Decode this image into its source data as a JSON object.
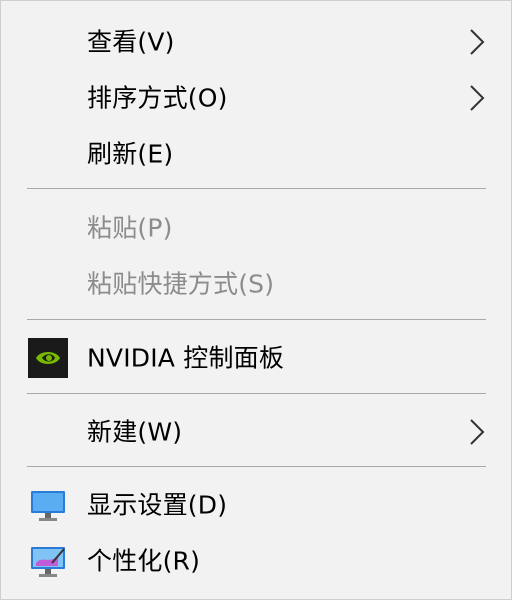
{
  "menu": {
    "items": [
      {
        "label": "查看(V)",
        "submenu": true,
        "enabled": true
      },
      {
        "label": "排序方式(O)",
        "submenu": true,
        "enabled": true
      },
      {
        "label": "刷新(E)",
        "submenu": false,
        "enabled": true
      },
      {
        "label": "粘贴(P)",
        "submenu": false,
        "enabled": false
      },
      {
        "label": "粘贴快捷方式(S)",
        "submenu": false,
        "enabled": false
      },
      {
        "label": "NVIDIA 控制面板",
        "submenu": false,
        "enabled": true,
        "icon": "nvidia-icon"
      },
      {
        "label": "新建(W)",
        "submenu": true,
        "enabled": true
      },
      {
        "label": "显示设置(D)",
        "submenu": false,
        "enabled": true,
        "icon": "display-settings-icon"
      },
      {
        "label": "个性化(R)",
        "submenu": false,
        "enabled": true,
        "icon": "personalize-icon"
      }
    ]
  },
  "colors": {
    "background": "#f2f2f2",
    "disabled_text": "#8c8c8c",
    "separator": "#a9a9a9",
    "nvidia_green": "#76b900"
  }
}
